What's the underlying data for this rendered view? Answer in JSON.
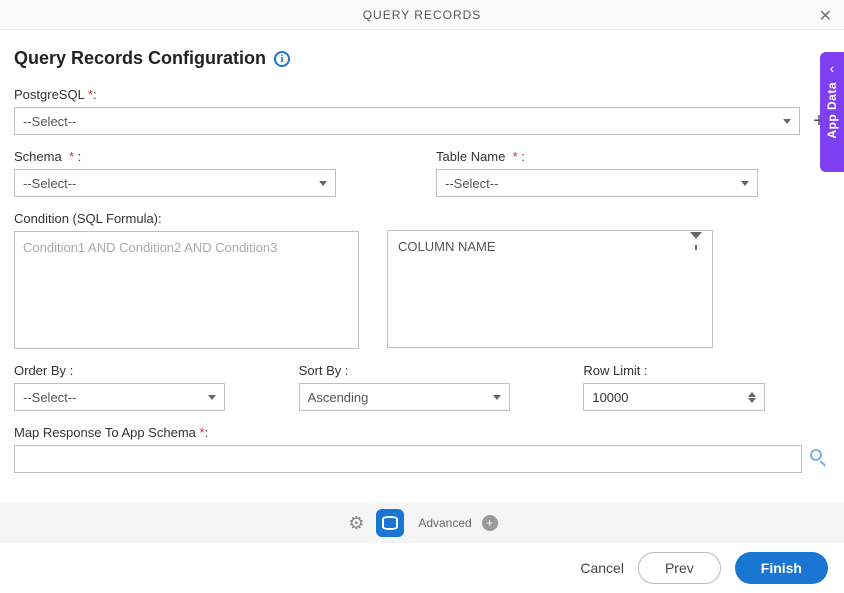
{
  "header": {
    "title": "QUERY RECORDS"
  },
  "pageTitle": "Query Records Configuration",
  "sideTab": {
    "label": "App Data"
  },
  "fields": {
    "postgresql": {
      "label": "PostgreSQL",
      "value": "--Select--"
    },
    "schema": {
      "label": "Schema",
      "value": "--Select--"
    },
    "tableName": {
      "label": "Table Name",
      "value": "--Select--"
    },
    "condition": {
      "label": "Condition (SQL Formula):",
      "placeholder": "Condition1 AND Condition2 AND Condition3"
    },
    "column": {
      "header": "COLUMN NAME"
    },
    "orderBy": {
      "label": "Order By :",
      "value": "--Select--"
    },
    "sortBy": {
      "label": "Sort By :",
      "value": "Ascending"
    },
    "rowLimit": {
      "label": "Row Limit :",
      "value": "10000"
    },
    "mapResponse": {
      "label": "Map Response To App Schema"
    }
  },
  "toolbar": {
    "advanced": "Advanced"
  },
  "footer": {
    "cancel": "Cancel",
    "prev": "Prev",
    "finish": "Finish"
  }
}
